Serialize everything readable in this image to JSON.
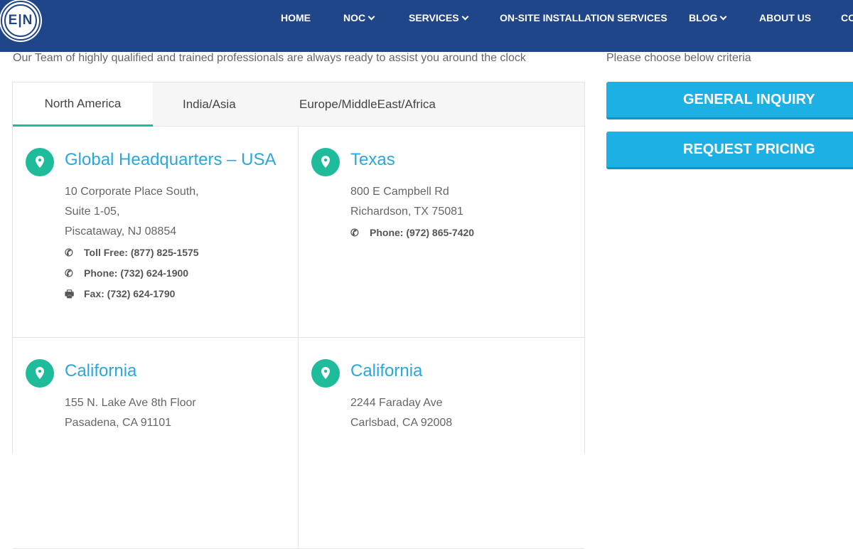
{
  "header": {
    "logo_text": "E|N",
    "nav": [
      {
        "label": "HOME",
        "dropdown": false
      },
      {
        "label": "NOC",
        "dropdown": true
      },
      {
        "label": "SERVICES",
        "dropdown": true
      },
      {
        "label": "ON-SITE INSTALLATION SERVICES",
        "dropdown": false
      },
      {
        "label": "BLOG",
        "dropdown": true
      },
      {
        "label": "ABOUT US",
        "dropdown": false
      },
      {
        "label": "CO",
        "dropdown": false
      }
    ]
  },
  "intro": "Our Team of highly qualified and trained professionals are always ready to assist you around the clock",
  "sidebar": {
    "criteria": "Please choose below criteria",
    "general_inquiry": "GENERAL INQUIRY",
    "request_pricing": "REQUEST PRICING"
  },
  "tabs": [
    {
      "label": "North America",
      "active": true
    },
    {
      "label": "India/Asia",
      "active": false
    },
    {
      "label": "Europe/MiddleEast/Africa",
      "active": false
    }
  ],
  "locations": [
    {
      "title": "Global Headquarters – USA",
      "address": [
        "10 Corporate Place South,",
        "Suite 1-05,",
        "Piscataway, NJ 08854"
      ],
      "contacts": [
        {
          "icon": "phone-icon",
          "text": "Toll Free: (877) 825-1575"
        },
        {
          "icon": "phone-icon",
          "text": "Phone: (732) 624-1900"
        },
        {
          "icon": "fax-icon",
          "text": "Fax: (732) 624-1790"
        }
      ]
    },
    {
      "title": "Texas",
      "address": [
        "800 E Campbell Rd",
        "Richardson, TX 75081"
      ],
      "contacts": [
        {
          "icon": "phone-icon",
          "text": "Phone: (972) 865-7420"
        }
      ]
    },
    {
      "title": "California",
      "address": [
        "155 N. Lake Ave 8th Floor",
        "Pasadena, CA 91101"
      ],
      "contacts": []
    },
    {
      "title": "California",
      "address": [
        "2244 Faraday Ave",
        "Carlsbad, CA 92008"
      ],
      "contacts": []
    }
  ],
  "colors": {
    "header": "#20468a",
    "button": "#1cb0e4",
    "accent": "#1fbc9c",
    "title": "#28a8df"
  }
}
